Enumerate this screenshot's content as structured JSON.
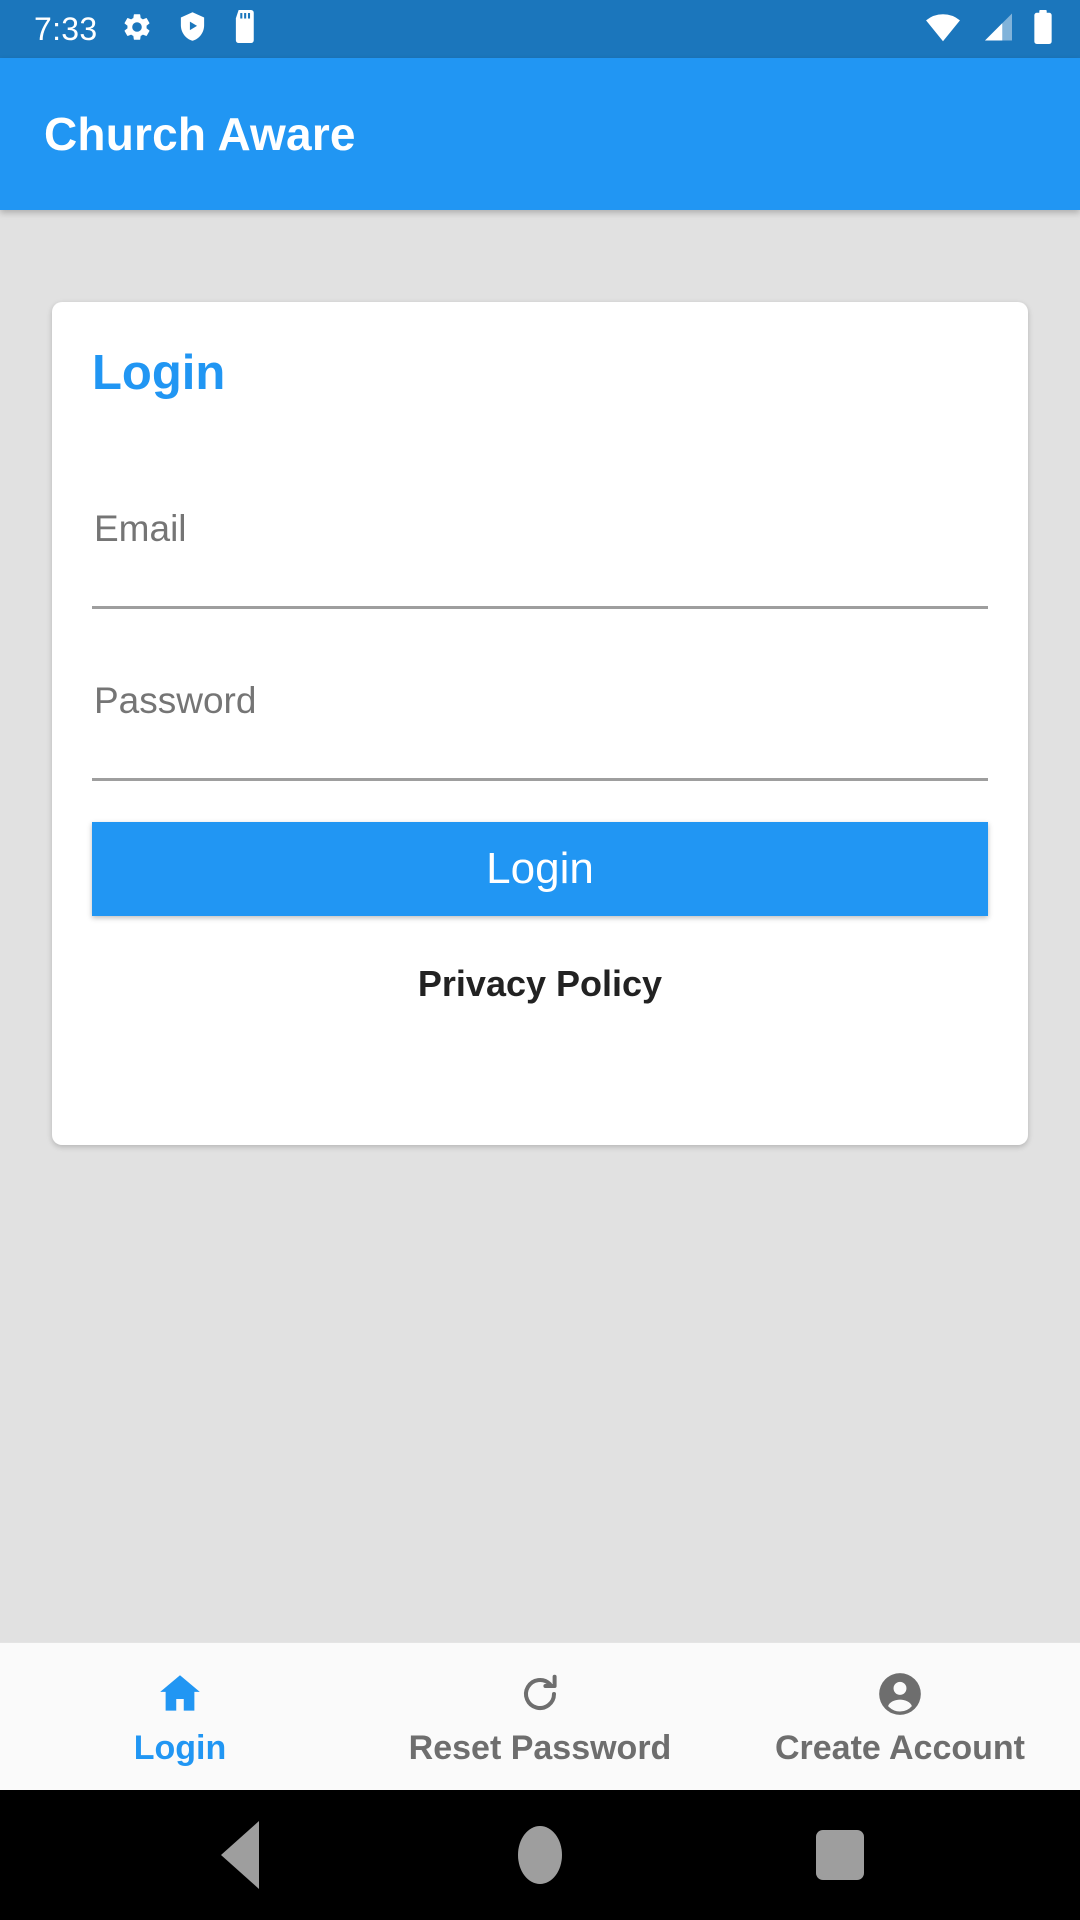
{
  "status_bar": {
    "time": "7:33",
    "left_icons": [
      "gear-icon",
      "play-protect-shield-icon",
      "sd-card-icon"
    ],
    "right_icons": [
      "wifi-icon",
      "cellular-signal-icon",
      "battery-icon"
    ],
    "background_color": "#1b76bc",
    "foreground_color": "#ffffff"
  },
  "app_bar": {
    "title": "Church Aware",
    "background_color": "#2196f3",
    "title_color": "#ffffff"
  },
  "page": {
    "background_color": "#e1e1e1"
  },
  "login_card": {
    "title": "Login",
    "title_color": "#2196f3",
    "background_color": "#ffffff",
    "fields": [
      {
        "name": "email",
        "placeholder": "Email",
        "value": ""
      },
      {
        "name": "password",
        "placeholder": "Password",
        "value": ""
      }
    ],
    "submit_button": {
      "label": "Login",
      "background_color": "#2196f3",
      "text_color": "#ffffff"
    },
    "privacy_link": {
      "label": "Privacy Policy",
      "color": "#222222"
    }
  },
  "tab_bar": {
    "background_color": "#fafafa",
    "active_color": "#2196f3",
    "inactive_color": "#6e6e6e",
    "tabs": [
      {
        "label": "Login",
        "icon": "home-icon",
        "active": true
      },
      {
        "label": "Reset Password",
        "icon": "refresh-icon",
        "active": false
      },
      {
        "label": "Create Account",
        "icon": "account-circle-icon",
        "active": false
      }
    ]
  },
  "nav_bar": {
    "background_color": "#000000",
    "buttons": [
      {
        "name": "back",
        "icon": "back-triangle-icon"
      },
      {
        "name": "home",
        "icon": "home-circle-icon"
      },
      {
        "name": "recents",
        "icon": "recents-square-icon"
      }
    ]
  }
}
